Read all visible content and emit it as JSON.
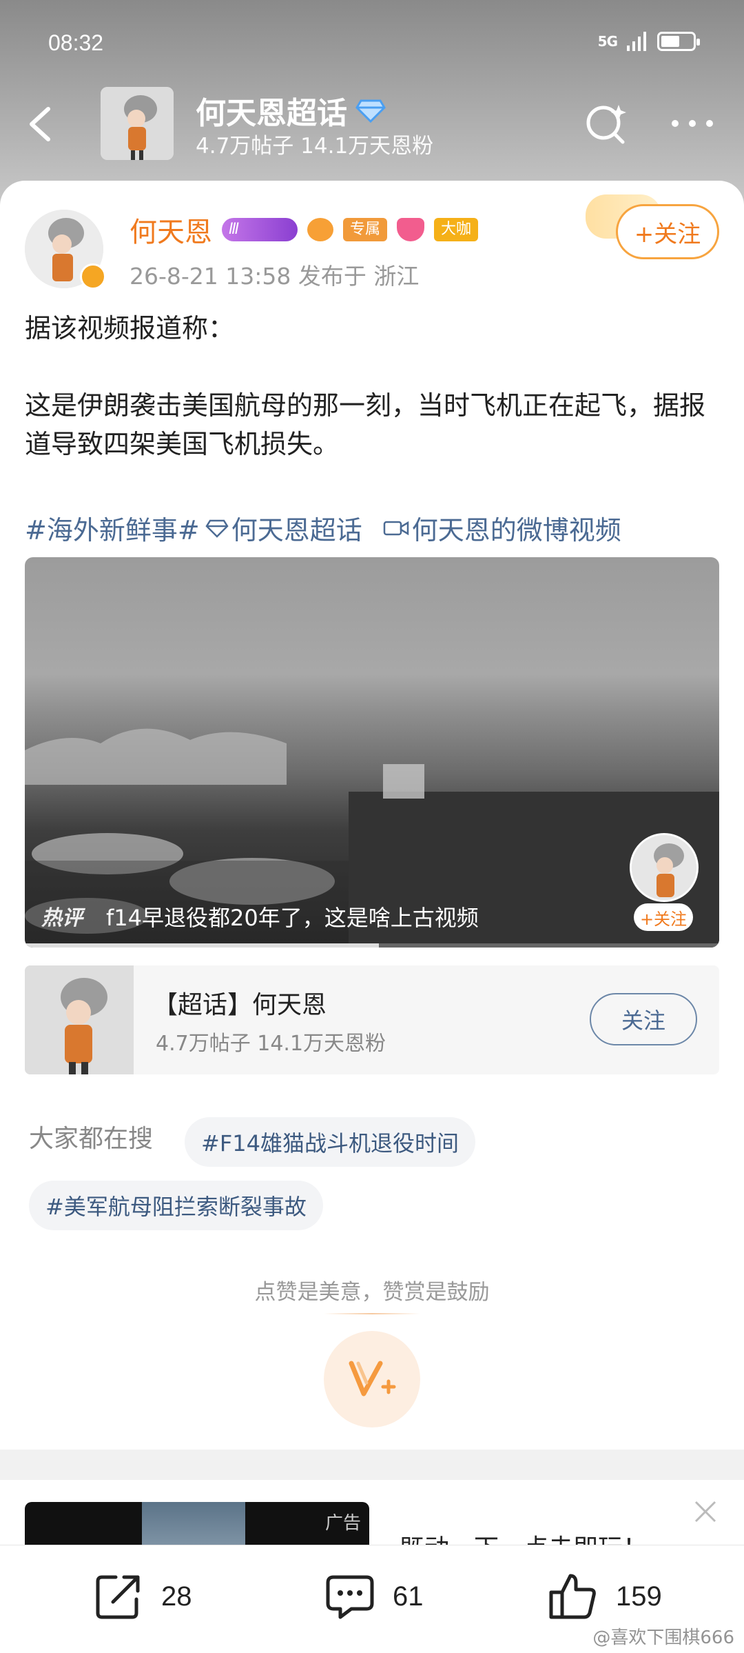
{
  "status": {
    "time": "08:32",
    "signal": "5G"
  },
  "header": {
    "title": "何天恩超话",
    "stats": "4.7万帖子 14.1万天恩粉"
  },
  "post": {
    "author": "何天恩",
    "level_badge": "Ⅲ",
    "badges": [
      "专属",
      "大咖"
    ],
    "meta": "26-8-21 13:58  发布于 浙江",
    "follow_label": "+关注",
    "paragraphs": [
      "据该视频报道称：",
      "这是伊朗袭击美国航母的那一刻，当时飞机正在起飞，据报道导致四架美国飞机损失。"
    ],
    "tags": [
      "#海外新鲜事#",
      "何天恩超话",
      "何天恩的微博视频"
    ]
  },
  "video": {
    "hot_label": "热评",
    "hot_comment": "f14早退役都20年了，这是啥上古视频",
    "follow_label": "+关注",
    "progress": 0.51
  },
  "topic_card": {
    "title": "【超话】何天恩",
    "stats": "4.7万帖子 14.1万天恩粉",
    "follow_label": "关注"
  },
  "search": {
    "label": "大家都在搜",
    "chips": [
      "#F14雄猫战斗机退役时间",
      "#美军航母阻拦索断裂事故"
    ]
  },
  "reward": {
    "text": "点赞是美意，赞赏是鼓励"
  },
  "ad": {
    "label": "广告",
    "text": "既动一下，点击即玩！"
  },
  "actions": {
    "share": "28",
    "comment": "61",
    "like": "159"
  },
  "watermark": "@喜欢下围棋666",
  "colors": {
    "accent_orange": "#f07a1e",
    "link_blue": "#4b6a93"
  }
}
